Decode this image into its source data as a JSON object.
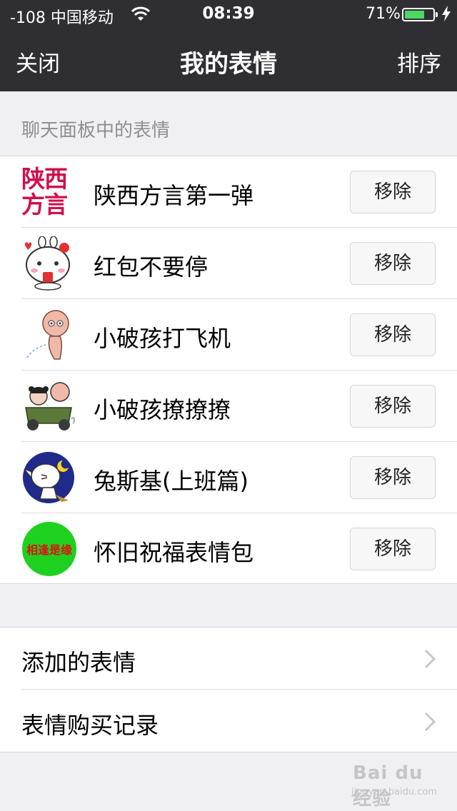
{
  "status_bar": {
    "carrier": "-108 中国移动",
    "time": "08:39",
    "battery_percent": "71%",
    "battery_level": 0.71,
    "battery_color": "#4cd964"
  },
  "nav": {
    "left_label": "关闭",
    "title": "我的表情",
    "right_label": "排序"
  },
  "section_header": "聊天面板中的表情",
  "sticker_packs": [
    {
      "name": "陕西方言第一弹",
      "remove_label": "移除",
      "thumb_text": "陕西方言",
      "icon": "shaanxi-dialect-thumb"
    },
    {
      "name": "红包不要停",
      "remove_label": "移除",
      "icon": "red-packet-bunny-thumb"
    },
    {
      "name": "小破孩打飞机",
      "remove_label": "移除",
      "icon": "little-kid-thumb"
    },
    {
      "name": "小破孩撩撩撩",
      "remove_label": "移除",
      "icon": "kids-motorcycle-thumb"
    },
    {
      "name": "兔斯基(上班篇)",
      "remove_label": "移除",
      "icon": "tuzki-moon-thumb"
    },
    {
      "name": "怀旧祝福表情包",
      "remove_label": "移除",
      "thumb_text": "相逢是缘",
      "icon": "green-circle-thumb"
    }
  ],
  "other_items": [
    {
      "label": "添加的表情"
    },
    {
      "label": "表情购买记录"
    }
  ],
  "watermark": {
    "main": "Bai du 经验",
    "sub": "jingyan.baidu.com"
  },
  "colors": {
    "nav_bg": "#2f2f33",
    "page_bg": "#efeff4",
    "pack1_text": "#d0104c",
    "green_badge": "#1fd11f",
    "badge_text": "#e01010"
  }
}
